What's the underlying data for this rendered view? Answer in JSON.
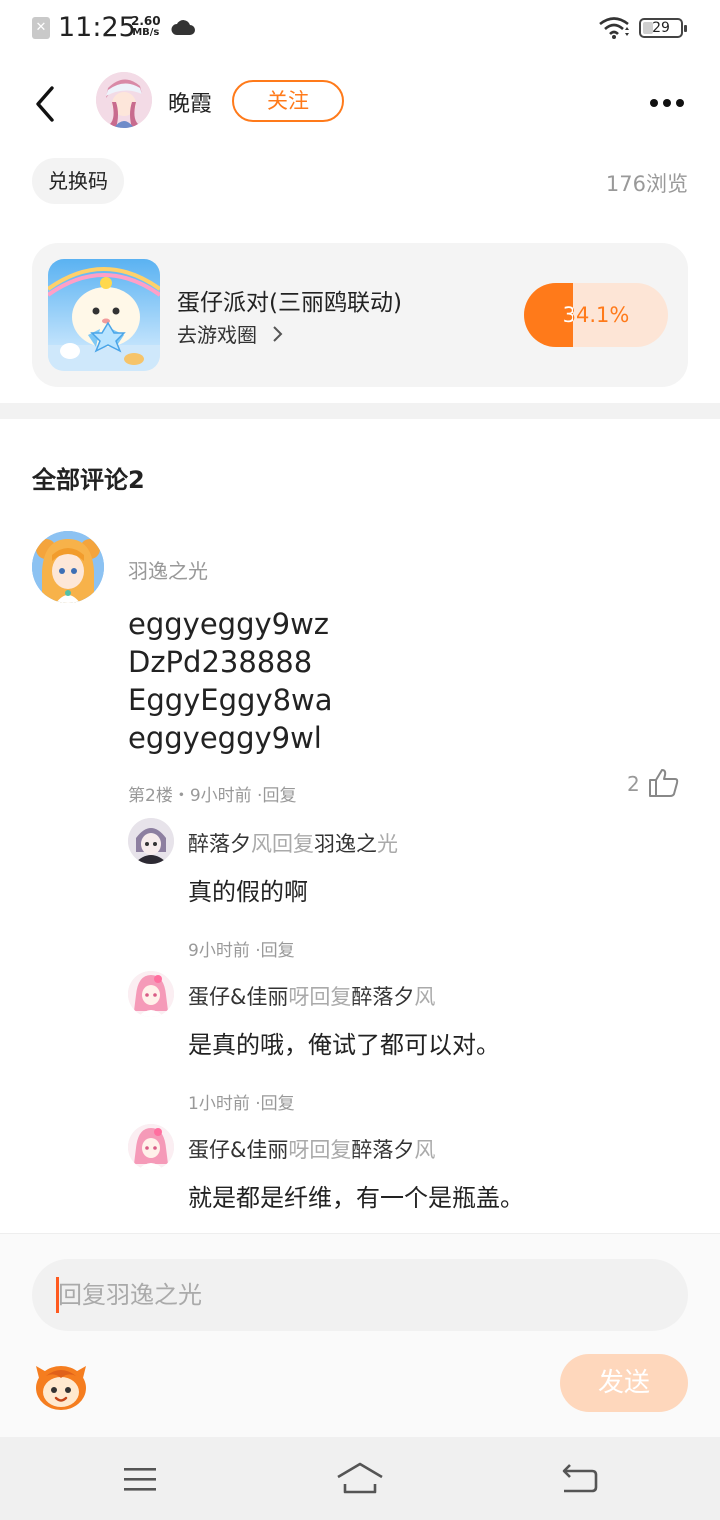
{
  "status_bar": {
    "time": "11:25",
    "net_speed_value": "2.60",
    "net_speed_unit": "MB/s",
    "battery": "29"
  },
  "header": {
    "author": "晚霞",
    "follow_label": "关注"
  },
  "post": {
    "tag": "兑换码",
    "views": "176浏览"
  },
  "game_card": {
    "name": "蛋仔派对(三丽鸥联动)",
    "link": "去游戏圈",
    "percent_label": "34.1%",
    "percent_value": 34.1
  },
  "comments": {
    "title": "全部评论2",
    "main": {
      "user": "羽逸之光",
      "lines": [
        "eggyeggy9wz",
        "DzPd238888",
        "EggyEggy8wa",
        "eggyeggy9wl"
      ],
      "meta": "第2楼・9小时前 ·回复",
      "likes": "2"
    },
    "replies": [
      {
        "name_a": "醉落夕",
        "name_a_tail": "风",
        "reply_word": "回复",
        "name_b": "羽逸之",
        "name_b_tail": "光",
        "text": "真的假的啊",
        "meta": "9小时前 ·回复"
      },
      {
        "name_a": "蛋仔&佳丽",
        "name_a_tail": "呀",
        "reply_word": "回复",
        "name_b": "醉落夕",
        "name_b_tail": "风",
        "text": "是真的哦，俺试了都可以对。",
        "meta": "1小时前 ·回复"
      },
      {
        "name_a": "蛋仔&佳丽",
        "name_a_tail": "呀",
        "reply_word": "回复",
        "name_b": "醉落夕",
        "name_b_tail": "风",
        "text": "就是都是纤维，有一个是瓶盖。",
        "meta": ""
      }
    ]
  },
  "composer": {
    "placeholder": "回复羽逸之光",
    "send_label": "发送"
  },
  "colors": {
    "accent": "#ff7a1a",
    "accent_light": "#fde5d6",
    "send_disabled": "#fed7bc"
  }
}
